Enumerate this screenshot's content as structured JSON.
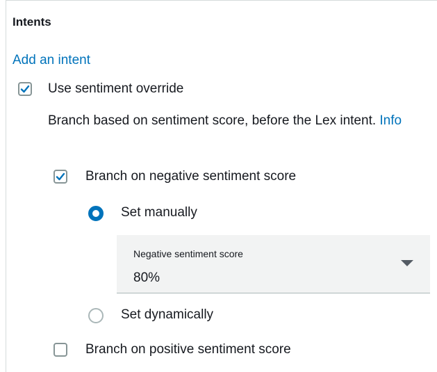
{
  "section": {
    "title": "Intents"
  },
  "add_intent_link": "Add an intent",
  "sentiment_override": {
    "checked": true,
    "label": "Use sentiment override",
    "description": "Branch based on sentiment score, before the Lex intent.",
    "info_link": "Info"
  },
  "negative_branch": {
    "checked": true,
    "label": "Branch on negative sentiment score",
    "set_manually": {
      "selected": true,
      "label": "Set manually"
    },
    "score_select": {
      "label": "Negative sentiment score",
      "value": "80%"
    },
    "set_dynamically": {
      "selected": false,
      "label": "Set dynamically"
    }
  },
  "positive_branch": {
    "checked": false,
    "label": "Branch on positive sentiment score"
  },
  "colors": {
    "link": "#0073bb",
    "radio_selected": "#0073bb",
    "checkmark": "#0073bb",
    "select_bg": "#f2f3f3"
  }
}
